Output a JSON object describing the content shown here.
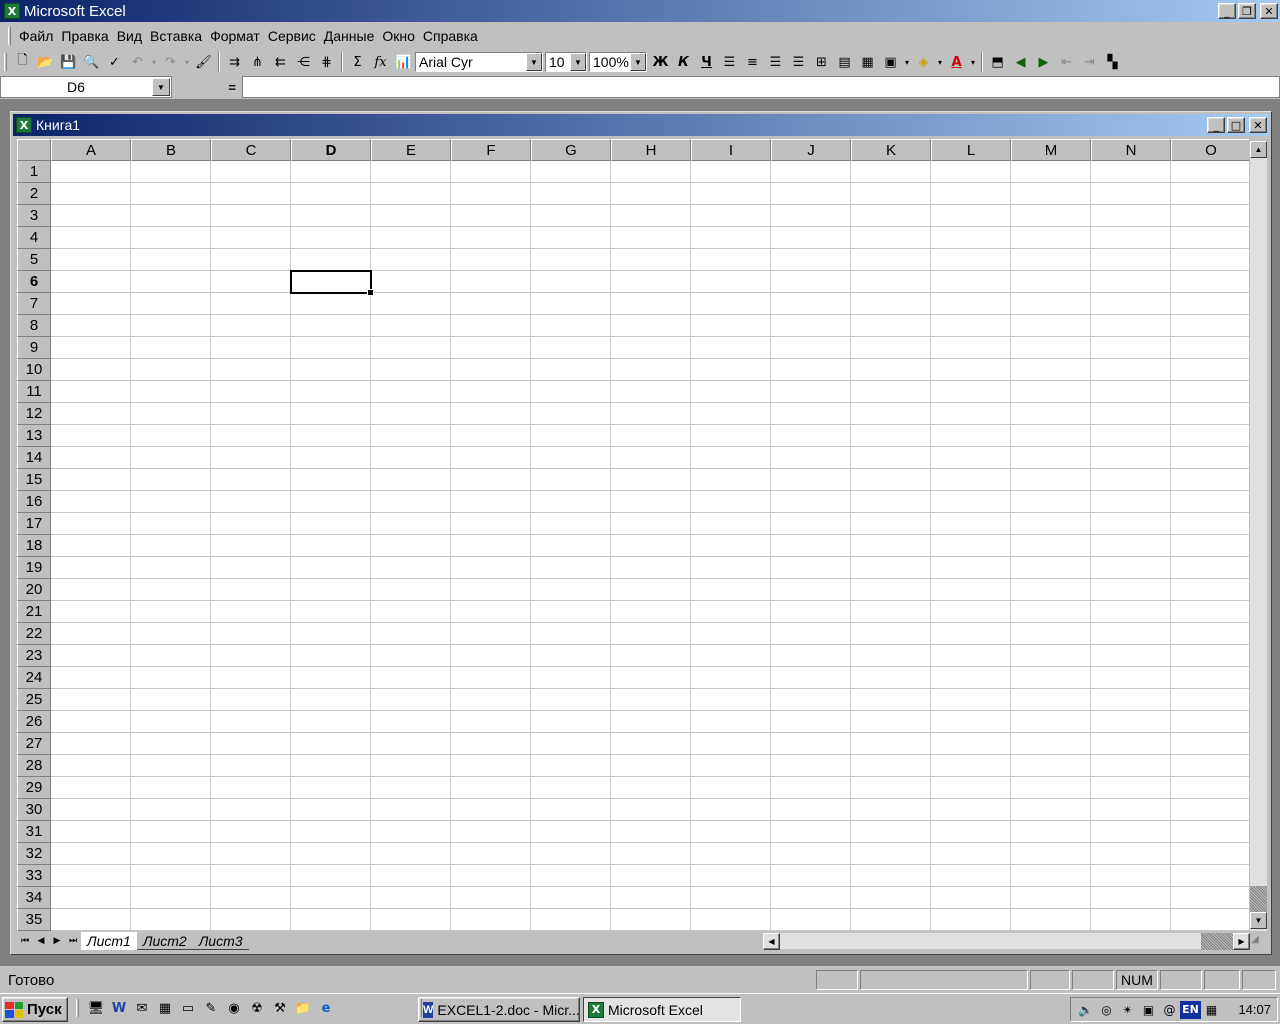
{
  "app": {
    "title": "Microsoft Excel"
  },
  "window_controls": {
    "minimize": "_",
    "restore": "❐",
    "close": "✕"
  },
  "menu": [
    {
      "label": "Файл"
    },
    {
      "label": "Правка"
    },
    {
      "label": "Вид"
    },
    {
      "label": "Вставка"
    },
    {
      "label": "Формат"
    },
    {
      "label": "Сервис"
    },
    {
      "label": "Данные"
    },
    {
      "label": "Окно"
    },
    {
      "label": "Справка"
    }
  ],
  "toolbar": {
    "font_name": "Arial Cyr",
    "font_size": "10",
    "zoom": "100%",
    "bold": "Ж",
    "italic": "К",
    "underline": "Ч",
    "sum": "Σ",
    "function": "fx"
  },
  "formula_bar": {
    "name_box": "D6",
    "equals": "=",
    "content": ""
  },
  "workbook": {
    "title": "Книга1",
    "columns": [
      "A",
      "B",
      "C",
      "D",
      "E",
      "F",
      "G",
      "H",
      "I",
      "J",
      "K",
      "L",
      "M",
      "N",
      "O"
    ],
    "rows": [
      "1",
      "2",
      "3",
      "4",
      "5",
      "6",
      "7",
      "8",
      "9",
      "10",
      "11",
      "12",
      "13",
      "14",
      "15",
      "16",
      "17",
      "18",
      "19",
      "20",
      "21",
      "22",
      "23",
      "24",
      "25",
      "26",
      "27",
      "28",
      "29",
      "30",
      "31",
      "32",
      "33",
      "34",
      "35"
    ],
    "active_col": "D",
    "active_row": "6",
    "sheets": [
      {
        "label": "Лист1",
        "active": true
      },
      {
        "label": "Лист2",
        "active": false
      },
      {
        "label": "Лист3",
        "active": false
      }
    ]
  },
  "status": {
    "left": "Готово",
    "num": "NUM"
  },
  "taskbar": {
    "start": "Пуск",
    "tasks": [
      {
        "label": "EXCEL1-2.doc - Micr..."
      },
      {
        "label": "Microsoft Excel"
      }
    ],
    "tray_lang": "EN",
    "clock": "14:07"
  },
  "colors": {
    "title_start": "#0a246a",
    "title_end": "#a6caf0",
    "excel_green": "#1d7a3a"
  }
}
